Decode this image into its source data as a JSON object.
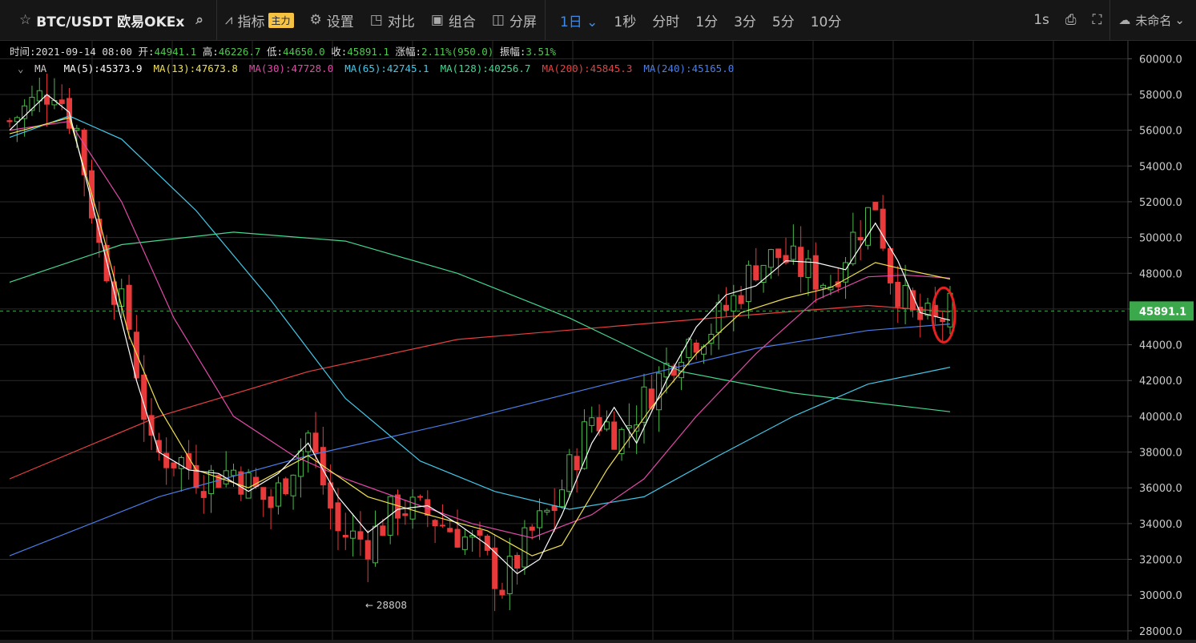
{
  "toolbar": {
    "symbol": "BTC/USDT 欧易OKEx",
    "indicator_label": "指标",
    "indicator_badge": "主力",
    "settings_label": "设置",
    "compare_label": "对比",
    "combo_label": "组合",
    "split_label": "分屏",
    "periods": [
      "1日",
      "1秒",
      "分时",
      "1分",
      "3分",
      "5分",
      "10分"
    ],
    "active_period": "1日",
    "interval_label": "1s",
    "unnamed_label": "未命名"
  },
  "info": {
    "time_label": "时间:",
    "time": "2021-09-14 08:00",
    "open_label": "开:",
    "open": "44941.1",
    "high_label": "高:",
    "high": "46226.7",
    "low_label": "低:",
    "low": "44650.0",
    "close_label": "收:",
    "close": "45891.1",
    "change_label": "涨幅:",
    "change": "2.11%(950.0)",
    "amp_label": "振幅:",
    "amp": "3.51%"
  },
  "ma_bar": {
    "label": "MA",
    "items": [
      {
        "text": "MA(5):45373.9",
        "color": "#ffffff"
      },
      {
        "text": "MA(13):47673.8",
        "color": "#f0e050"
      },
      {
        "text": "MA(30):47728.0",
        "color": "#e04aa8"
      },
      {
        "text": "MA(65):42745.1",
        "color": "#44c8e8"
      },
      {
        "text": "MA(128):40256.7",
        "color": "#44d890"
      },
      {
        "text": "MA(200):45845.3",
        "color": "#e84040"
      },
      {
        "text": "MA(240):45165.0",
        "color": "#4a7ee8"
      }
    ]
  },
  "colors": {
    "up": "#4cb84c",
    "down": "#e83a3a",
    "grid": "#2a2a2a",
    "last_price_bg": "#3ca84c"
  },
  "chart_data": {
    "type": "candlestick",
    "ylim": [
      27500,
      61000
    ],
    "yticks": [
      "28000.0",
      "30000.0",
      "32000.0",
      "34000.0",
      "36000.0",
      "38000.0",
      "40000.0",
      "42000.0",
      "44000.0",
      "46000.0",
      "48000.0",
      "50000.0",
      "52000.0",
      "54000.0",
      "56000.0",
      "58000.0",
      "60000.0"
    ],
    "last_price": "45891.1",
    "min_label": "← 28808",
    "anchors": [
      [
        0,
        56500
      ],
      [
        6,
        58500
      ],
      [
        9,
        56000
      ],
      [
        12,
        49500
      ],
      [
        16,
        45000
      ],
      [
        19,
        38000
      ],
      [
        23,
        37500
      ],
      [
        26,
        36500
      ],
      [
        30,
        37000
      ],
      [
        35,
        35000
      ],
      [
        40,
        39000
      ],
      [
        44,
        33500
      ],
      [
        48,
        33000
      ],
      [
        52,
        35000
      ],
      [
        56,
        34500
      ],
      [
        60,
        33500
      ],
      [
        63,
        32500
      ],
      [
        66,
        30500
      ],
      [
        70,
        33500
      ],
      [
        73,
        35000
      ],
      [
        78,
        40000
      ],
      [
        82,
        39000
      ],
      [
        86,
        41500
      ],
      [
        90,
        44000
      ],
      [
        94,
        45000
      ],
      [
        97,
        46500
      ],
      [
        100,
        48500
      ],
      [
        103,
        49000
      ],
      [
        107,
        48000
      ],
      [
        110,
        47500
      ],
      [
        113,
        50000
      ],
      [
        116,
        52000
      ],
      [
        118,
        48000
      ],
      [
        121,
        45500
      ],
      [
        124,
        45200
      ],
      [
        126,
        45891
      ]
    ],
    "ma_lines": [
      {
        "name": "MA(240)",
        "color": "#4a7ee8",
        "pts": [
          [
            0,
            32200
          ],
          [
            20,
            35500
          ],
          [
            40,
            37800
          ],
          [
            60,
            39700
          ],
          [
            80,
            41800
          ],
          [
            100,
            43800
          ],
          [
            115,
            44800
          ],
          [
            126,
            45165
          ]
        ]
      },
      {
        "name": "MA(200)",
        "color": "#e84040",
        "pts": [
          [
            0,
            36500
          ],
          [
            20,
            40000
          ],
          [
            40,
            42500
          ],
          [
            60,
            44300
          ],
          [
            80,
            45000
          ],
          [
            100,
            45700
          ],
          [
            115,
            46200
          ],
          [
            126,
            45845
          ]
        ]
      },
      {
        "name": "MA(128)",
        "color": "#44d890",
        "pts": [
          [
            0,
            47500
          ],
          [
            15,
            49600
          ],
          [
            30,
            50300
          ],
          [
            45,
            49800
          ],
          [
            60,
            48000
          ],
          [
            75,
            45500
          ],
          [
            90,
            42500
          ],
          [
            105,
            41300
          ],
          [
            126,
            40257
          ]
        ]
      },
      {
        "name": "MA(65)",
        "color": "#44c8e8",
        "pts": [
          [
            0,
            55600
          ],
          [
            8,
            56800
          ],
          [
            15,
            55500
          ],
          [
            25,
            51500
          ],
          [
            35,
            46500
          ],
          [
            45,
            41000
          ],
          [
            55,
            37500
          ],
          [
            65,
            35800
          ],
          [
            75,
            34800
          ],
          [
            85,
            35500
          ],
          [
            95,
            37800
          ],
          [
            105,
            40000
          ],
          [
            115,
            41800
          ],
          [
            126,
            42745
          ]
        ]
      },
      {
        "name": "MA(30)",
        "color": "#e04aa8",
        "pts": [
          [
            0,
            56000
          ],
          [
            8,
            56500
          ],
          [
            15,
            52000
          ],
          [
            22,
            45500
          ],
          [
            30,
            40000
          ],
          [
            38,
            37800
          ],
          [
            45,
            36500
          ],
          [
            55,
            35000
          ],
          [
            62,
            34000
          ],
          [
            70,
            33200
          ],
          [
            78,
            34500
          ],
          [
            85,
            36500
          ],
          [
            92,
            40000
          ],
          [
            100,
            43500
          ],
          [
            108,
            46500
          ],
          [
            115,
            47800
          ],
          [
            120,
            47900
          ],
          [
            126,
            47728
          ]
        ]
      },
      {
        "name": "MA(13)",
        "color": "#f0e050",
        "pts": [
          [
            0,
            55800
          ],
          [
            8,
            56700
          ],
          [
            12,
            51000
          ],
          [
            16,
            44500
          ],
          [
            20,
            40500
          ],
          [
            25,
            37000
          ],
          [
            32,
            36000
          ],
          [
            40,
            37800
          ],
          [
            48,
            35500
          ],
          [
            56,
            34500
          ],
          [
            64,
            33600
          ],
          [
            70,
            32200
          ],
          [
            74,
            32800
          ],
          [
            80,
            37000
          ],
          [
            86,
            40500
          ],
          [
            92,
            43500
          ],
          [
            98,
            45800
          ],
          [
            104,
            46600
          ],
          [
            110,
            47200
          ],
          [
            116,
            48600
          ],
          [
            120,
            48200
          ],
          [
            126,
            47674
          ]
        ]
      },
      {
        "name": "MA(5)",
        "color": "#ffffff",
        "pts": [
          [
            0,
            56000
          ],
          [
            5,
            58000
          ],
          [
            8,
            57000
          ],
          [
            11,
            52000
          ],
          [
            14,
            47000
          ],
          [
            17,
            42000
          ],
          [
            20,
            38000
          ],
          [
            24,
            37000
          ],
          [
            28,
            36800
          ],
          [
            32,
            35800
          ],
          [
            36,
            36800
          ],
          [
            40,
            38500
          ],
          [
            44,
            35500
          ],
          [
            48,
            33500
          ],
          [
            52,
            34800
          ],
          [
            56,
            35000
          ],
          [
            60,
            34000
          ],
          [
            64,
            32800
          ],
          [
            68,
            31200
          ],
          [
            71,
            32000
          ],
          [
            74,
            34500
          ],
          [
            78,
            38500
          ],
          [
            81,
            40500
          ],
          [
            84,
            38500
          ],
          [
            88,
            42000
          ],
          [
            92,
            45000
          ],
          [
            96,
            46800
          ],
          [
            100,
            47300
          ],
          [
            104,
            48700
          ],
          [
            108,
            48600
          ],
          [
            112,
            48200
          ],
          [
            116,
            50800
          ],
          [
            119,
            48700
          ],
          [
            122,
            45800
          ],
          [
            126,
            45374
          ]
        ]
      }
    ]
  }
}
